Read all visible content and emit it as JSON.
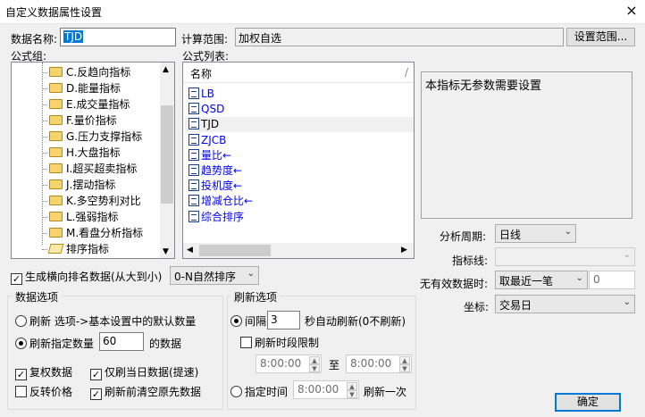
{
  "window": {
    "title": "自定义数据属性设置",
    "close_glyph": "×"
  },
  "data_name": {
    "label": "数据名称:",
    "value": "TJD"
  },
  "calc_range": {
    "label": "计算范围:",
    "value": "加权自选",
    "button": "设置范围..."
  },
  "formula_group": {
    "label": "公式组:",
    "items": [
      {
        "label": "C.反趋向指标",
        "icon": "folder-icon"
      },
      {
        "label": "D.能量指标",
        "icon": "folder-icon"
      },
      {
        "label": "E.成交量指标",
        "icon": "folder-icon"
      },
      {
        "label": "F.量价指标",
        "icon": "folder-icon"
      },
      {
        "label": "G.压力支撑指标",
        "icon": "folder-icon"
      },
      {
        "label": "H.大盘指标",
        "icon": "folder-icon"
      },
      {
        "label": "I.超买超卖指标",
        "icon": "folder-icon"
      },
      {
        "label": "J.摆动指标",
        "icon": "folder-icon"
      },
      {
        "label": "K.多空势利对比",
        "icon": "folder-icon"
      },
      {
        "label": "L.强弱指标",
        "icon": "folder-icon"
      },
      {
        "label": "M.看盘分析指标",
        "icon": "folder-icon"
      },
      {
        "label": "排序指标",
        "icon": "folder-open-icon"
      }
    ]
  },
  "formula_list": {
    "label": "公式列表:",
    "header": "名称",
    "header_mark": "/",
    "items": [
      "LB",
      "QSD",
      "TJD",
      "ZJCB",
      "量比←",
      "趋势度←",
      "投机度←",
      "增减仓比←",
      "综合排序"
    ],
    "selected_index": 2
  },
  "param_box": {
    "text": "本指标无参数需要设置"
  },
  "right_settings": {
    "period": {
      "label": "分析周期:",
      "value": "日线"
    },
    "indicator_line": {
      "label": "指标线:",
      "value": ""
    },
    "no_data": {
      "label": "无有效数据时:",
      "value": "取最近一笔",
      "extra_value": "0"
    },
    "axis": {
      "label": "坐标:",
      "value": "交易日"
    }
  },
  "generate_rank": {
    "label": "生成横向排名数据(从大到小)",
    "checked": true,
    "option": "0-N自然排序"
  },
  "data_options": {
    "title": "数据选项",
    "radio_default": "刷新 选项->基本设置中的默认数量",
    "radio_custom": "刷新指定数量",
    "custom_count": "60",
    "custom_suffix": "的数据",
    "selected": "custom",
    "checks": [
      {
        "label": "复权数据",
        "checked": true
      },
      {
        "label": "仅刷当日数据(提速)",
        "checked": true
      },
      {
        "label": "反转价格",
        "checked": false
      },
      {
        "label": "刷新前清空原先数据",
        "checked": true
      }
    ]
  },
  "refresh_options": {
    "title": "刷新选项",
    "interval_label": "间隔",
    "interval_value": "3",
    "interval_suffix": "秒自动刷新(0不刷新)",
    "time_limit_label": "刷新时段限制",
    "time_limit_checked": false,
    "from_time": "8:00:00",
    "to_label": "至",
    "to_time": "8:00:00",
    "fixed_time_label": "指定时间",
    "fixed_time": "8:00:00",
    "fixed_time_suffix": "刷新一次",
    "selected": "interval"
  },
  "ok_button": "确定"
}
